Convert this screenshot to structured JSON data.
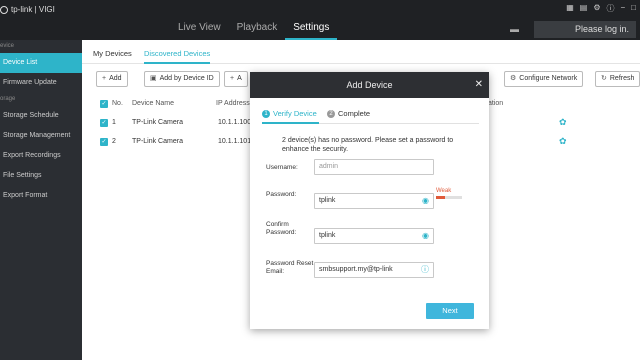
{
  "app": {
    "logo_text": "tp-link | VIGI"
  },
  "topnav": [
    {
      "label": "Live View"
    },
    {
      "label": "Playback"
    },
    {
      "label": "Settings"
    }
  ],
  "top": {
    "login_label": "Please log in."
  },
  "sidebar": {
    "section_device": "evice",
    "items_device": [
      "Device List",
      "Firmware Update"
    ],
    "section_storage": "orage",
    "items_storage": [
      "Storage Schedule",
      "Storage Management",
      "Export Recordings",
      "File Settings",
      "Export Format"
    ]
  },
  "tabs": [
    "My Devices",
    "Discovered Devices"
  ],
  "toolbar": {
    "add": "Add",
    "add_by_id": "Add by Device ID",
    "a": "A",
    "configure_network": "Configure Network",
    "refresh": "Refresh"
  },
  "table": {
    "headers": {
      "no": "No.",
      "name": "Device Name",
      "ip": "IP Address",
      "op": "ation"
    },
    "rows": [
      {
        "no": "1",
        "name": "TP-Link Camera",
        "ip": "10.1.1.100"
      },
      {
        "no": "2",
        "name": "TP-Link Camera",
        "ip": "10.1.1.101"
      }
    ]
  },
  "modal": {
    "title": "Add Device",
    "steps": [
      {
        "num": "1",
        "label": "Verify Device"
      },
      {
        "num": "2",
        "label": "Complete"
      }
    ],
    "message": "2 device(s) has no password. Please set a password to enhance the security.",
    "username_label": "Username:",
    "username_placeholder": "admin",
    "password_label": "Password:",
    "password_value": "tplink",
    "strength_label": "Weak",
    "strength_level": 0.35,
    "confirm_label": "Confirm Password:",
    "confirm_value": "tplink",
    "email_label": "Password Reset Email:",
    "email_value": "smbsupport.my@tp-link",
    "next_label": "Next"
  }
}
